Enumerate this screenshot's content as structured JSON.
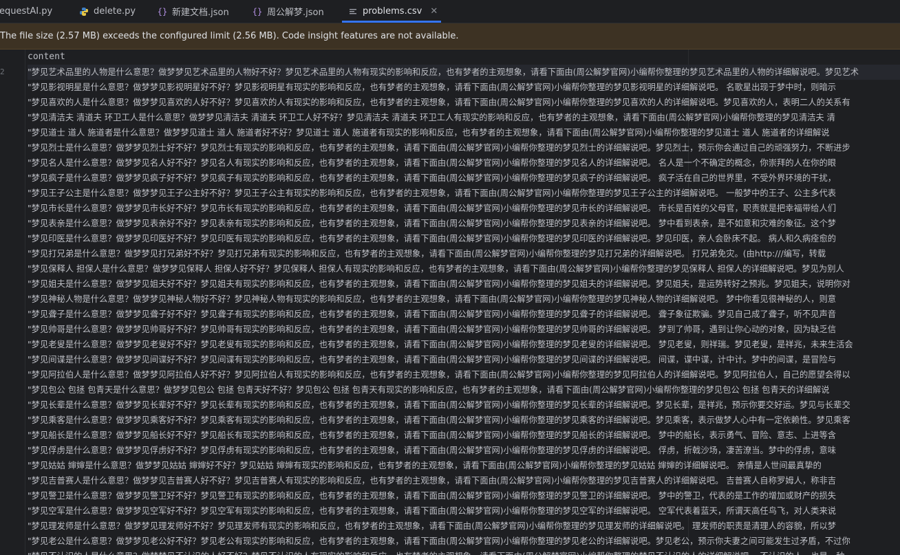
{
  "tabs": [
    {
      "label": "requestAI.py",
      "icon": "python-file-icon"
    },
    {
      "label": "delete.py",
      "icon": "python-file-icon"
    },
    {
      "label": "新建文档.json",
      "icon": "json-file-icon"
    },
    {
      "label": "周公解梦.json",
      "icon": "json-file-icon"
    },
    {
      "label": "problems.csv",
      "icon": "csv-file-icon",
      "active": true
    }
  ],
  "banner": {
    "message": "The file size (2.57 MB) exceeds the configured limit (2.56 MB). Code insight features are not available."
  },
  "editor": {
    "header": "content",
    "lines": [
      "\"梦见艺术品里的人物是什么意思？做梦梦见艺术品里的人物好不好？梦见艺术品里的人物有现实的影响和反应，也有梦者的主观想象，请看下面由(周公解梦官网)小编帮你整理的梦见艺术品里的人物的详细解说吧。梦见艺术",
      "\"梦见影视明星是什么意思？做梦梦见影视明星好不好？梦见影视明星有现实的影响和反应，也有梦者的主观想象，请看下面由(周公解梦官网)小编帮你整理的梦见影视明星的详细解说吧。    名歌星出现于梦中时，则暗示",
      "\"梦见喜欢的人是什么意思？做梦梦见喜欢的人好不好？梦见喜欢的人有现实的影响和反应，也有梦者的主观想象，请看下面由(周公解梦官网)小编帮你整理的梦见喜欢的人的详细解说吧。梦见喜欢的人，表明二人的关系有",
      "\"梦见清洁夫  清道夫  环卫工人是什么意思？做梦梦见清洁夫  清道夫  环卫工人好不好？梦见清洁夫  清道夫  环卫工人有现实的影响和反应，也有梦者的主观想象，请看下面由(周公解梦官网)小编帮你整理的梦见清洁夫  清",
      "\"梦见道士  道人  施道者是什么意思？做梦梦见道士  道人  施道者好不好？梦见道士  道人  施道者有现实的影响和反应，也有梦者的主观想象，请看下面由(周公解梦官网)小编帮你整理的梦见道士  道人  施道者的详细解说",
      "\"梦见烈士是什么意思？做梦梦见烈士好不好？梦见烈士有现实的影响和反应，也有梦者的主观想象，请看下面由(周公解梦官网)小编帮你整理的梦见烈士的详细解说吧。梦见烈士，预示你会通过自己的顽强努力，不断进步",
      "\"梦见名人是什么意思？做梦梦见名人好不好？梦见名人有现实的影响和反应，也有梦者的主观想象，请看下面由(周公解梦官网)小编帮你整理的梦见名人的详细解说吧。    名人是一个不确定的概念，你崇拜的人在你的眼",
      "\"梦见疯子是什么意思？做梦梦见疯子好不好？梦见疯子有现实的影响和反应，也有梦者的主观想象，请看下面由(周公解梦官网)小编帮你整理的梦见疯子的详细解说吧。    疯子活在自己的世界里，不受外界环境的干扰，",
      "\"梦见王子公主是什么意思？做梦梦见王子公主好不好？梦见王子公主有现实的影响和反应，也有梦者的主观想象，请看下面由(周公解梦官网)小编帮你整理的梦见王子公主的详细解说吧。    一般梦中的王子、公主多代表",
      "\"梦见市长是什么意思？做梦梦见市长好不好？梦见市长有现实的影响和反应，也有梦者的主观想象，请看下面由(周公解梦官网)小编帮你整理的梦见市长的详细解说吧。    市长是百姓的父母官，职责就是把幸福带给人们",
      "\"梦见表亲是什么意思？做梦梦见表亲好不好？梦见表亲有现实的影响和反应，也有梦者的主观想象，请看下面由(周公解梦官网)小编帮你整理的梦见表亲的详细解说吧。    梦中看到表亲，是不如意和灾难的象征。这个梦",
      "\"梦见印医是什么意思？做梦梦见印医好不好？梦见印医有现实的影响和反应，也有梦者的主观想象，请看下面由(周公解梦官网)小编帮你整理的梦见印医的详细解说吧。梦见印医，亲人会卧床不起。    病人和久病痊愈的",
      "\"梦见打兄弟是什么意思？做梦梦见打兄弟好不好？梦见打兄弟有现实的影响和反应，也有梦者的主观想象，请看下面由(周公解梦官网)小编帮你整理的梦见打兄弟的详细解说吧。    打兄弟免灾。(由http:///编写，转载",
      "\"梦见保释人  担保人是什么意思？做梦梦见保释人  担保人好不好？梦见保释人  担保人有现实的影响和反应，也有梦者的主观想象，请看下面由(周公解梦官网)小编帮你整理的梦见保释人  担保人的详细解说吧。梦见为别人",
      "\"梦见姐夫是什么意思？做梦梦见姐夫好不好？梦见姐夫有现实的影响和反应，也有梦者的主观想象，请看下面由(周公解梦官网)小编帮你整理的梦见姐夫的详细解说吧。梦见姐夫，是运势转好之预兆。梦见姐夫，说明你对",
      "\"梦见神秘人物是什么意思？做梦梦见神秘人物好不好？梦见神秘人物有现实的影响和反应，也有梦者的主观想象，请看下面由(周公解梦官网)小编帮你整理的梦见神秘人物的详细解说吧。    梦中你看见很神秘的人，则意",
      "\"梦见聋子是什么意思？做梦梦见聋子好不好？梦见聋子有现实的影响和反应，也有梦者的主观想象，请看下面由(周公解梦官网)小编帮你整理的梦见聋子的详细解说吧。    聋子象征欺骗。梦见自己成了聋子，听不见声音",
      "\"梦见帅哥是什么意思？做梦梦见帅哥好不好？梦见帅哥有现实的影响和反应，也有梦者的主观想象，请看下面由(周公解梦官网)小编帮你整理的梦见帅哥的详细解说吧。    梦到了帅哥，遇到让你心动的对象，因为缺乏信",
      "\"梦见老叟是什么意思？做梦梦见老叟好不好？梦见老叟有现实的影响和反应，也有梦者的主观想象，请看下面由(周公解梦官网)小编帮你整理的梦见老叟的详细解说吧。    梦见老叟，则祥瑞。梦见老叟，是祥兆，未来生活会",
      "\"梦见间谍是什么意思？做梦梦见间谍好不好？梦见间谍有现实的影响和反应，也有梦者的主观想象，请看下面由(周公解梦官网)小编帮你整理的梦见间谍的详细解说吧。    间谍，谍中谍，计中计。梦中的间谍，是冒险与",
      "\"梦见阿拉伯人是什么意思？做梦梦见阿拉伯人好不好？梦见阿拉伯人有现实的影响和反应，也有梦者的主观想象，请看下面由(周公解梦官网)小编帮你整理的梦见阿拉伯人的详细解说吧。梦见阿拉伯人，自己的愿望会得以",
      "\"梦见包公  包拯  包青天是什么意思？做梦梦见包公  包拯  包青天好不好？梦见包公  包拯  包青天有现实的影响和反应，也有梦者的主观想象，请看下面由(周公解梦官网)小编帮你整理的梦见包公  包拯  包青天的详细解说",
      "\"梦见长辈是什么意思？做梦梦见长辈好不好？梦见长辈有现实的影响和反应，也有梦者的主观想象，请看下面由(周公解梦官网)小编帮你整理的梦见长辈的详细解说吧。梦见长辈，是祥兆，预示你要交好运。梦见与长辈交",
      "\"梦见乘客是什么意思？做梦梦见乘客好不好？梦见乘客有现实的影响和反应，也有梦者的主观想象，请看下面由(周公解梦官网)小编帮你整理的梦见乘客的详细解说吧。梦见乘客，表示做梦人心中有一定依赖性。梦见乘客",
      "\"梦见船长是什么意思？做梦梦见船长好不好？梦见船长有现实的影响和反应，也有梦者的主观想象，请看下面由(周公解梦官网)小编帮你整理的梦见船长的详细解说吧。    梦中的船长，表示勇气、冒险、意志、上进等含",
      "\"梦见俘虏是什么意思？做梦梦见俘虏好不好？梦见俘虏有现实的影响和反应，也有梦者的主观想象，请看下面由(周公解梦官网)小编帮你整理的梦见俘虏的详细解说吧。    俘虏，折戟沙场，凄苦潦当。梦中的俘虏，意味",
      "\"梦见姑姑  婶婶是什么意思？做梦梦见姑姑  婶婶好不好？梦见姑姑  婶婶有现实的影响和反应，也有梦者的主观想象，请看下面由(周公解梦官网)小编帮你整理的梦见姑姑  婶婶的详细解说吧。    亲情是人世间最真挚的",
      "\"梦见吉普赛人是什么意思？做梦梦见吉普赛人好不好？梦见吉普赛人有现实的影响和反应，也有梦者的主观想象，请看下面由(周公解梦官网)小编帮你整理的梦见吉普赛人的详细解说吧。    吉普赛人自称罗姆人，称非吉",
      "\"梦见警卫是什么意思？做梦梦见警卫好不好？梦见警卫有现实的影响和反应，也有梦者的主观想象，请看下面由(周公解梦官网)小编帮你整理的梦见警卫的详细解说吧。    梦中的警卫，代表的是工作的增加或财产的损失",
      "\"梦见空军是什么意思？做梦梦见空军好不好？梦见空军有现实的影响和反应，也有梦者的主观想象，请看下面由(周公解梦官网)小编帮你整理的梦见空军的详细解说吧。    空军代表着蓝天，所谓天高任鸟飞，对人类来说",
      "\"梦见理发师是什么意思？做梦梦见理发师好不好？梦见理发师有现实的影响和反应，也有梦者的主观想象，请看下面由(周公解梦官网)小编帮你整理的梦见理发师的详细解说吧。    理发师的职责是清理人的容貌，所以梦",
      "\"梦见老公是什么意思？做梦梦见老公好不好？梦见老公有现实的影响和反应，也有梦者的主观想象，请看下面由(周公解梦官网)小编帮你整理的梦见老公的详细解说吧。梦见老公，预示你夫妻之间可能发生过矛盾，不过你",
      "\"梦见不认识的人是什么意思？做梦梦见不认识的人好不好？梦见不认识的人有现实的影响和反应，也有梦者的主观想象，请看下面由(周公解梦官网)小编帮你整理的梦见不认识的人的详细解说吧。    不认识的人，也是一种"
    ]
  }
}
